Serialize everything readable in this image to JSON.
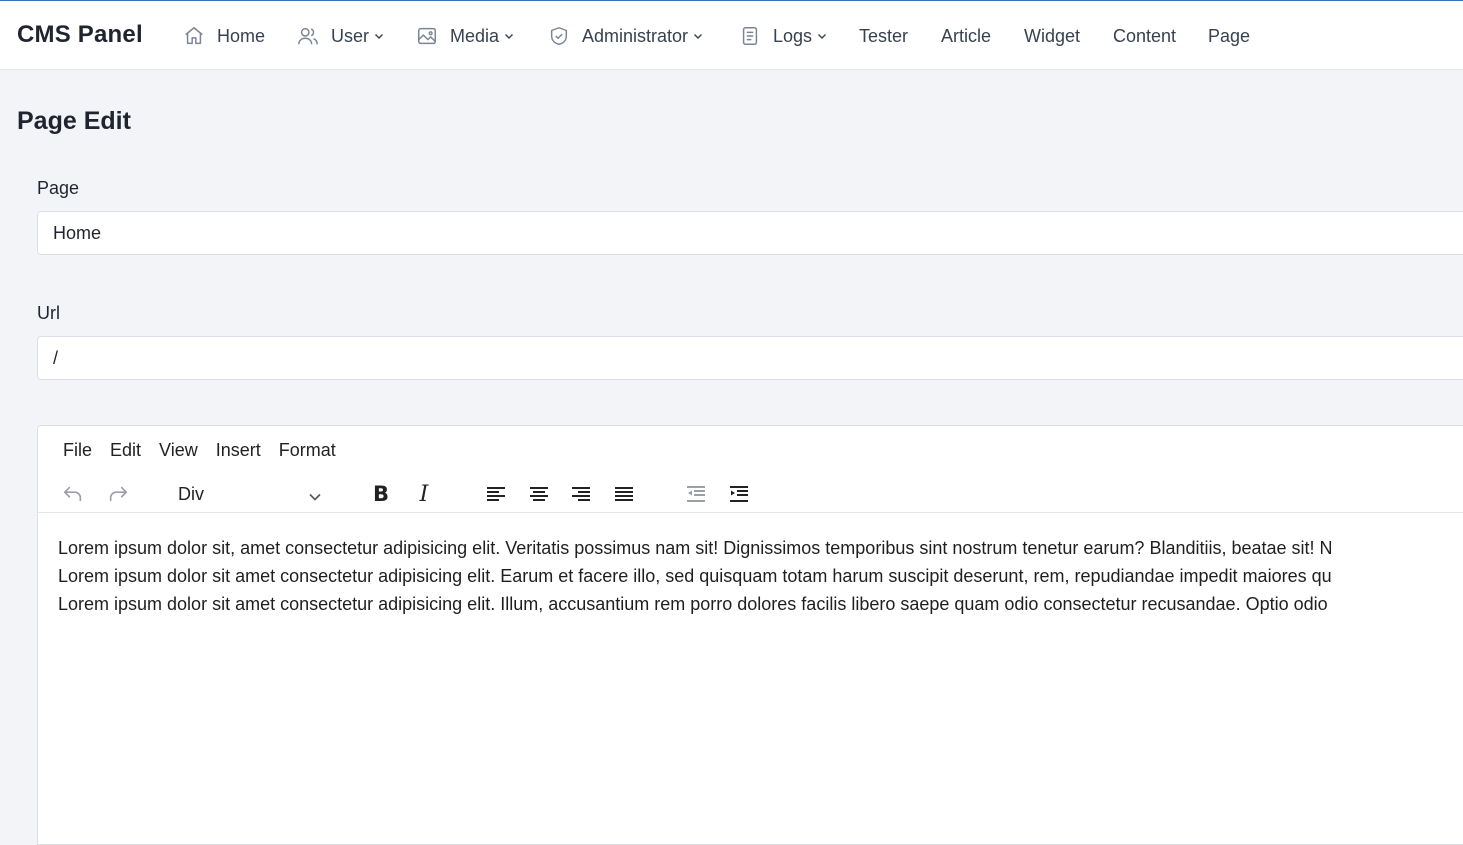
{
  "app": {
    "brand": "CMS Panel"
  },
  "nav": {
    "home": "Home",
    "user": "User",
    "media": "Media",
    "administrator": "Administrator",
    "logs": "Logs",
    "tester": "Tester",
    "article": "Article",
    "widget": "Widget",
    "content": "Content",
    "page": "Page"
  },
  "page": {
    "title": "Page Edit"
  },
  "form": {
    "page_label": "Page",
    "page_value": "Home",
    "url_label": "Url",
    "url_value": "/"
  },
  "editor": {
    "menu": {
      "file": "File",
      "edit": "Edit",
      "view": "View",
      "insert": "Insert",
      "format": "Format"
    },
    "block_format": "Div",
    "paragraphs": [
      "Lorem ipsum dolor sit, amet consectetur adipisicing elit. Veritatis possimus nam sit! Dignissimos temporibus sint nostrum tenetur earum? Blanditiis, beatae sit! N",
      "Lorem ipsum dolor sit amet consectetur adipisicing elit. Earum et facere illo, sed quisquam totam harum suscipit deserunt, rem, repudiandae impedit maiores qu",
      "Lorem ipsum dolor sit amet consectetur adipisicing elit. Illum, accusantium rem porro dolores facilis libero saepe quam odio consectetur recusandae. Optio odio"
    ]
  }
}
